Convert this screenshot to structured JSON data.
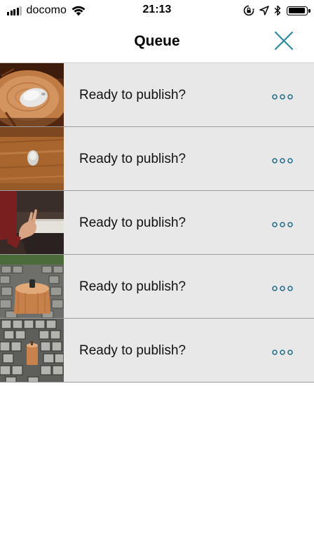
{
  "status_bar": {
    "carrier": "docomo",
    "time": "21:13",
    "signal_bars": 4,
    "signal_bars_total": 5,
    "icons": [
      "signal-icon",
      "wifi-icon",
      "rotation-lock-icon",
      "location-arrow-icon",
      "bluetooth-icon",
      "battery-icon"
    ]
  },
  "nav": {
    "title": "Queue",
    "close_icon": "close-icon",
    "accent_color": "#2a8ba3"
  },
  "queue": {
    "items": [
      {
        "label": "Ready to publish?",
        "thumbnail": "mouse-on-wooden-table",
        "more_icon": "more-dots-icon"
      },
      {
        "label": "Ready to publish?",
        "thumbnail": "mouse-on-wooden-board",
        "more_icon": "more-dots-icon"
      },
      {
        "label": "Ready to publish?",
        "thumbnail": "hand-gesture-indoor",
        "more_icon": "more-dots-icon"
      },
      {
        "label": "Ready to publish?",
        "thumbnail": "wooden-stump-on-cobblestone",
        "more_icon": "more-dots-icon"
      },
      {
        "label": "Ready to publish?",
        "thumbnail": "small-wooden-post-on-cobblestone",
        "more_icon": "more-dots-icon"
      }
    ]
  }
}
